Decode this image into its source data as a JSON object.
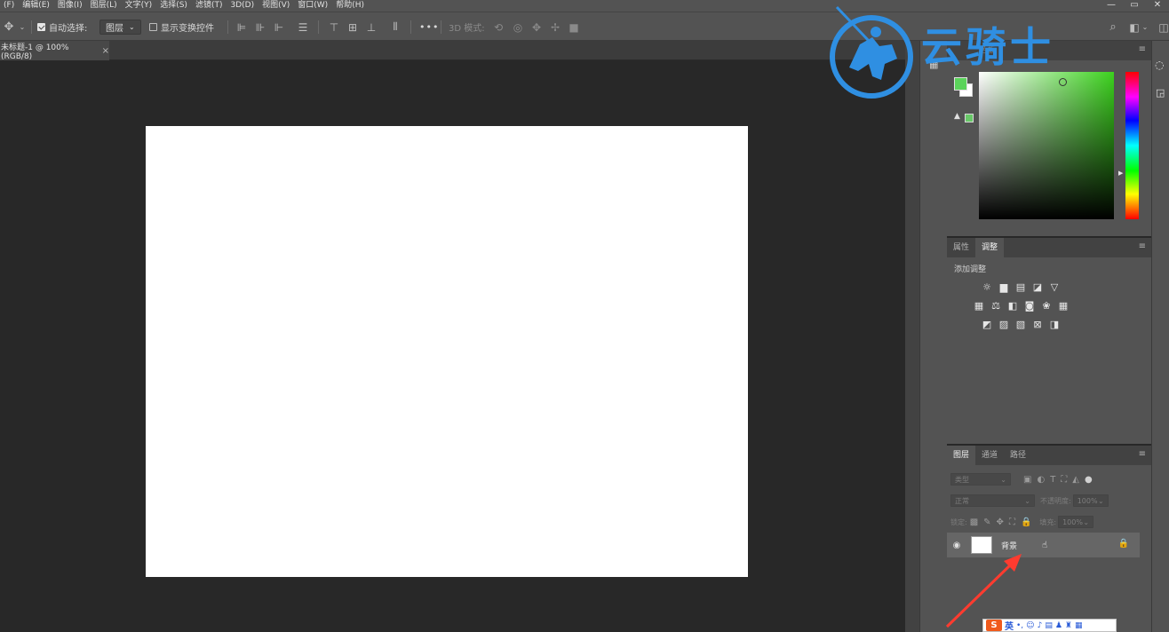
{
  "menubar": {
    "items": [
      "(F)",
      "编辑(E)",
      "图像(I)",
      "图层(L)",
      "文字(Y)",
      "选择(S)",
      "滤镜(T)",
      "3D(D)",
      "视图(V)",
      "窗口(W)",
      "帮助(H)"
    ],
    "window_controls": [
      "—",
      "▭",
      "✕"
    ]
  },
  "options": {
    "auto_select_label": "自动选择:",
    "auto_select_checked": true,
    "auto_select_target": "图层",
    "show_transform_label": "显示变换控件",
    "show_transform_checked": false,
    "mode_3d_label": "3D 模式:",
    "more_label": "•••"
  },
  "document": {
    "tab_title": "未标题-1 @ 100%(RGB/8)",
    "close_symbol": "×"
  },
  "color_panel": {
    "tab_label": "色板",
    "foreground_color": "#5bd35b",
    "background_color": "#ffffff",
    "menu_icon": "≡"
  },
  "adjustments_panel": {
    "tabs": [
      "属性",
      "调整"
    ],
    "active_tab": "调整",
    "title": "添加调整",
    "menu_icon": "≡"
  },
  "layers_panel": {
    "tabs": [
      "图层",
      "通道",
      "路径"
    ],
    "active_tab": "图层",
    "filter_placeholder": "类型",
    "blend_mode": "正常",
    "opacity_label": "不透明度:",
    "opacity_value": "100%",
    "lock_label": "锁定:",
    "fill_label": "填充:",
    "fill_value": "100%",
    "layers": [
      {
        "name": "背景",
        "visible": true,
        "locked": true
      }
    ],
    "menu_icon": "≡"
  },
  "watermark": {
    "text": "云骑士",
    "color": "#2f8fe2"
  },
  "ime": {
    "logo": "S",
    "mode": "英"
  },
  "colors": {
    "accent_arrow": "#ff3b2f"
  }
}
